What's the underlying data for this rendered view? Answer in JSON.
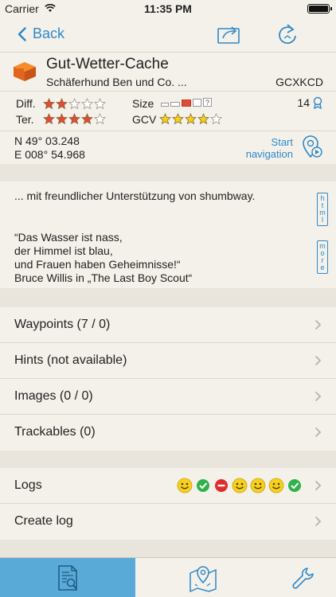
{
  "status": {
    "carrier": "Carrier",
    "time": "11:35 PM"
  },
  "nav": {
    "back_label": "Back"
  },
  "cache": {
    "name": "Gut-Wetter-Cache",
    "owner": "Schäferhund Ben und Co. ...",
    "code": "GCXKCD",
    "difficulty_label": "Diff.",
    "terrain_label": "Ter.",
    "size_label": "Size",
    "gcv_label": "GCV",
    "difficulty": 2,
    "terrain": 4,
    "gcv": 4,
    "size": "small",
    "favorites": "14"
  },
  "coords": {
    "lat": "N 49° 03.248",
    "lon": "E 008° 54.968",
    "nav_line1": "Start",
    "nav_line2": "navigation"
  },
  "description": {
    "intro": "... mit freundlicher Unterstützung von shumbway.",
    "quote": "“Das Wasser ist nass,\nder Himmel ist blau,\nund Frauen haben Geheimnisse!“\nBruce Willis in „The Last Boy Scout“",
    "html_button": "html",
    "more_button": "more"
  },
  "sections": [
    {
      "label": "Waypoints (7 / 0)"
    },
    {
      "label": "Hints (not available)"
    },
    {
      "label": "Images (0 / 0)"
    },
    {
      "label": "Trackables (0)"
    }
  ],
  "logs": {
    "label": "Logs",
    "create_label": "Create log",
    "icons": [
      "smiley-icon",
      "found-check-icon",
      "dnf-icon",
      "smiley-icon",
      "smiley-icon",
      "smiley-icon",
      "found-check-icon"
    ]
  },
  "colors": {
    "accent": "#2e88c9",
    "star_filled": "#e14a36",
    "gcv_star": "#f2cf1f",
    "tab_active": "#5aaad8",
    "background": "#e9e5dd"
  }
}
